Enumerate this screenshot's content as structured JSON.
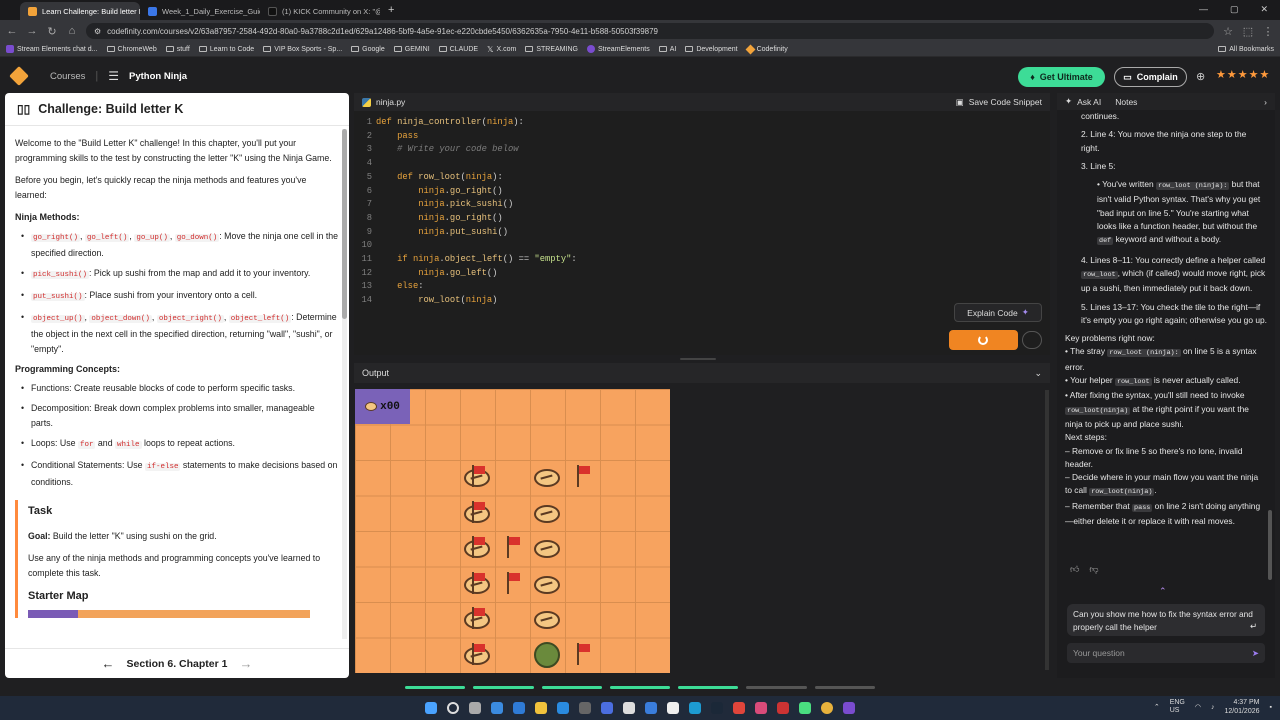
{
  "browser": {
    "tabs": [
      {
        "label": "Learn Challenge: Build letter K |",
        "active": true,
        "color": "#f2a33a"
      },
      {
        "label": "Week_1_Daily_Exercise_Guide.d",
        "active": false,
        "color": "#3b77e8"
      },
      {
        "label": "(1) KICK Community on X: \"@p",
        "active": false,
        "color": "#111111"
      }
    ],
    "url": "codefinity.com/courses/v2/63a87957-2584-492d-80a0-9a3788c2d1ed/629a12486-5bf9-4a5e-91ec-e220cbde5450/6362635a-7950-4e11-b588-50503f39879",
    "bookmarks": [
      "Stream Elements chat d...",
      "ChromeWeb",
      "stuff",
      "Learn to Code",
      "VIP Box Sports - Sp...",
      "Google",
      "GEMINI",
      "CLAUDE",
      "X.com",
      "STREAMING",
      "StreamElements",
      "AI",
      "Development",
      "Codefinity"
    ],
    "all_bookmarks": "All Bookmarks"
  },
  "header": {
    "courses": "Courses",
    "course_title": "Python Ninja",
    "get_ultimate": "Get Ultimate",
    "complain": "Complain",
    "stars": "★★★★★"
  },
  "left": {
    "title": "Challenge: Build letter K",
    "intro1": "Welcome to the \"Build Letter K\" challenge! In this chapter, you'll put your programming skills to the test by constructing the letter \"K\" using the Ninja Game.",
    "intro2": "Before you begin, let's quickly recap the ninja methods and features you've learned:",
    "methods_title": "Ninja Methods:",
    "m1_code": [
      "go_right()",
      "go_left()",
      "go_up()",
      "go_down()"
    ],
    "m1_text": ": Move the ninja one cell in the specified direction.",
    "m2_code": "pick_sushi()",
    "m2_text": ": Pick up sushi from the map and add it to your inventory.",
    "m3_code": "put_sushi()",
    "m3_text": ": Place sushi from your inventory onto a cell.",
    "m4_code": [
      "object_up()",
      "object_down()",
      "object_right()",
      "object_left()"
    ],
    "m4_text": ": Determine the object in the next cell in the specified direction, returning \"wall\", \"sushi\", or \"empty\".",
    "concepts_title": "Programming Concepts:",
    "c1": "Functions: Create reusable blocks of code to perform specific tasks.",
    "c2": "Decomposition: Break down complex problems into smaller, manageable parts.",
    "c3_pre": "Loops: Use ",
    "c3_for": "for",
    "c3_mid": " and ",
    "c3_while": "while",
    "c3_post": " loops to repeat actions.",
    "c4_pre": "Conditional Statements: Use ",
    "c4_code": "if-else",
    "c4_post": " statements to make decisions based on conditions.",
    "task_title": "Task",
    "goal_label": "Goal:",
    "goal_text": " Build the letter \"K\" using sushi on the grid.",
    "task_text": "Use any of the ninja methods and programming concepts you've learned to complete this task.",
    "starter_title": "Starter Map",
    "footer": "Section 6. Chapter 1"
  },
  "editor": {
    "filename": "ninja.py",
    "save_snippet": "Save Code Snippet",
    "explain": "Explain Code",
    "lines": [
      {
        "n": "1",
        "html": "<span class='kw'>def</span> <span class='fn'>ninja_controller</span><span class='tx'>(</span><span class='kw'>ninja</span><span class='tx'>):</span>"
      },
      {
        "n": "2",
        "html": "    <span class='kw'>pass</span>"
      },
      {
        "n": "3",
        "html": "    <span class='cm'># Write your code below</span>"
      },
      {
        "n": "4",
        "html": ""
      },
      {
        "n": "5",
        "html": "    <span class='kw'>def</span> <span class='fn'>row_loot</span><span class='tx'>(</span><span class='kw'>ninja</span><span class='tx'>):</span>"
      },
      {
        "n": "6",
        "html": "        <span class='kw'>ninja</span><span class='tx'>.</span><span class='fn'>go_right</span><span class='tx'>()</span>"
      },
      {
        "n": "7",
        "html": "        <span class='kw'>ninja</span><span class='tx'>.</span><span class='fn'>pick_sushi</span><span class='tx'>()</span>"
      },
      {
        "n": "8",
        "html": "        <span class='kw'>ninja</span><span class='tx'>.</span><span class='fn'>go_right</span><span class='tx'>()</span>"
      },
      {
        "n": "9",
        "html": "        <span class='kw'>ninja</span><span class='tx'>.</span><span class='fn'>put_sushi</span><span class='tx'>()</span>"
      },
      {
        "n": "10",
        "html": ""
      },
      {
        "n": "11",
        "html": "    <span class='kw'>if</span> <span class='kw'>ninja</span><span class='tx'>.</span><span class='fn'>object_left</span><span class='tx'>() == </span><span class='st'>\"empty\"</span><span class='tx'>:</span>"
      },
      {
        "n": "12",
        "html": "        <span class='kw'>ninja</span><span class='tx'>.</span><span class='fn'>go_left</span><span class='tx'>()</span>"
      },
      {
        "n": "13",
        "html": "    <span class='kw'>else</span><span class='tx'>:</span>"
      },
      {
        "n": "14",
        "html": "        <span class='fn'>row_loot</span><span class='tx'>(</span><span class='kw'>ninja</span><span class='tx'>)</span>"
      }
    ]
  },
  "output": {
    "title": "Output",
    "inventory": "x00"
  },
  "right": {
    "tab_ask": "Ask AI",
    "tab_notes": "Notes",
    "chat_html": "<div class='ci'>continues.</div><div class='ci'>2. Line 4: You move the ninja one step to the right.</div><div class='ci'>3. Line 5:</div><div class='sub'>• You've written <span class='ck'>row_loot (ninja):</span> but that isn't valid Python syntax. That's why you get \"bad input on line 5.\" You're starting what looks like a function header, but without the <span class='ck'>def</span> keyword and without a body.</div><div class='ci'>4. Lines 8–11: You correctly define a helper called <span class='ck'>row_loot</span>, which (if called) would move right, pick up a sushi, then immediately put it back down.</div><div class='ci'>5. Lines 13–17: You check the tile to the right—if it's empty you go right again; otherwise you go up.</div><div class='blk'>Key problems right now:</div><div class='blk'>• The stray <span class='ck'>row_loot (ninja):</span> on line 5 is a syntax error.</div><div class='blk'>• Your helper <span class='ck'>row_loot</span> is never actually called.</div><div class='blk'>• After fixing the syntax, you'll still need to invoke <span class='ck'>row_loot(ninja)</span> at the right point if you want the ninja to pick up and place sushi.</div><div class='blk'>Next steps:</div><div class='blk'>– Remove or fix line 5 so there's no lone, invalid header.</div><div class='blk'>– Decide where in your main flow you want the ninja to call <span class='ck'>row_loot(ninja)</span>.</div><div class='blk'>– Remember that <span class='ck'>pass</span> on line 2 isn't doing anything—either delete it or replace it with real moves.</div>",
    "user_question": "Can you show me how to fix the syntax error and properly call the helper",
    "placeholder": "Your question"
  },
  "tray": {
    "lang": "ENG\nUS",
    "time": "4:37 PM",
    "date": "12/01/2026"
  }
}
